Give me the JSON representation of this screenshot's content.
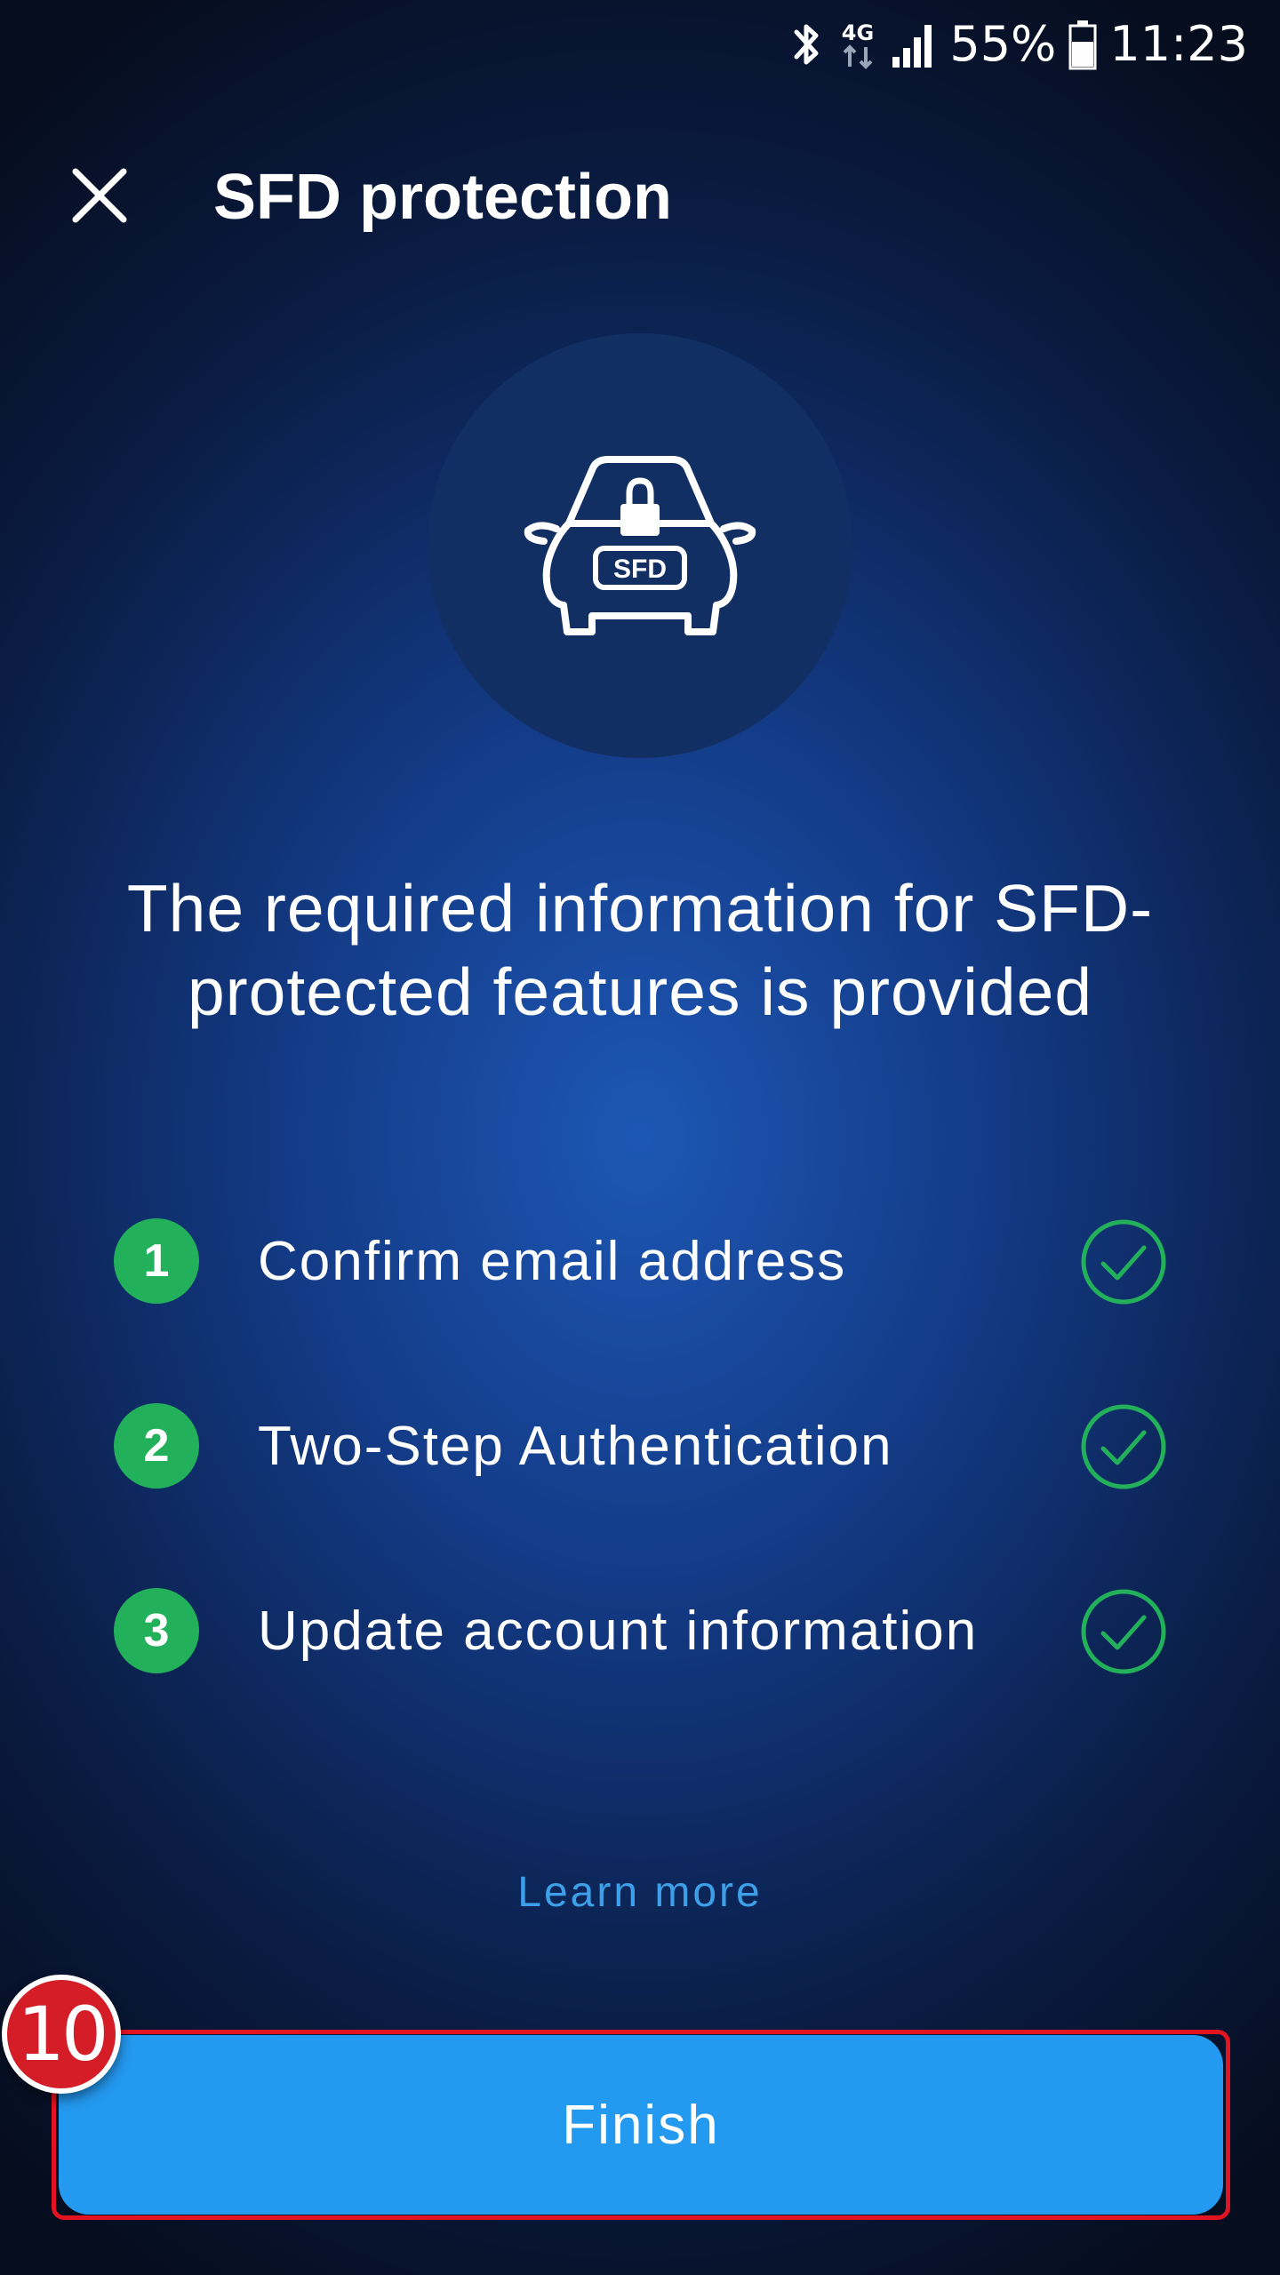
{
  "status_bar": {
    "network": "4G",
    "battery": "55%",
    "time": "11:23",
    "icons": [
      "bluetooth-icon",
      "network-4g-icon",
      "signal-icon",
      "battery-icon"
    ]
  },
  "app_bar": {
    "title": "SFD protection",
    "close_icon": "close-icon"
  },
  "hero": {
    "icon": "car-lock-icon",
    "badge_text": "SFD"
  },
  "heading": "The required information for SFD-protected features is provided",
  "steps": [
    {
      "number": "1",
      "label": "Confirm email address",
      "status": "complete"
    },
    {
      "number": "2",
      "label": "Two-Step Authentication",
      "status": "complete"
    },
    {
      "number": "3",
      "label": "Update account information",
      "status": "complete"
    }
  ],
  "learn_more": "Learn more",
  "finish_button": {
    "label": "Finish"
  },
  "annotation": {
    "step_number": "10"
  },
  "colors": {
    "accent": "#2499f0",
    "success": "#22b15a",
    "link": "#3c9fe8",
    "highlight": "#e31422",
    "background_dark": "#060d1f",
    "background_center": "#1d57b5"
  }
}
